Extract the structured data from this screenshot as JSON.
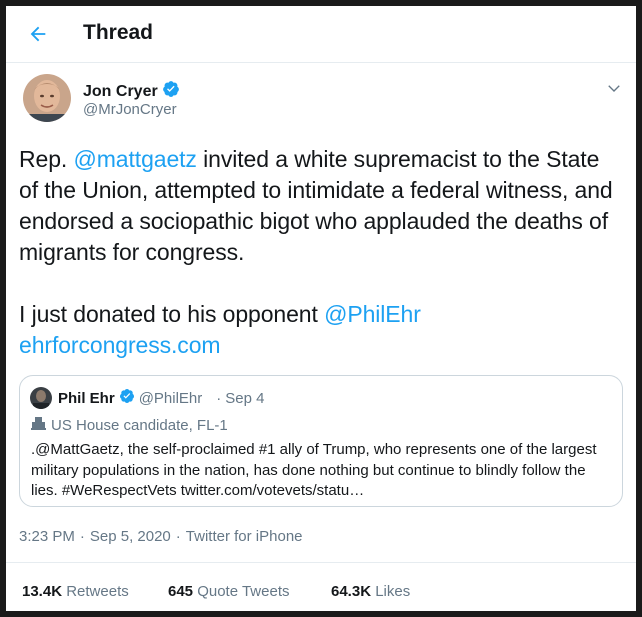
{
  "header": {
    "title": "Thread"
  },
  "tweet": {
    "author_name": "Jon Cryer",
    "author_handle": "@MrJonCryer",
    "line1_pre": "Rep. ",
    "line1_mention": "@mattgaetz",
    "line1_post": " invited a white supremacist to the State of the Union, attempted to intimidate a federal witness, and endorsed a sociopathic bigot who applauded the deaths of migrants for congress.",
    "line2_pre": "I just donated to his opponent ",
    "line2_mention": "@PhilEhr",
    "line3_link": "ehrforcongress.com"
  },
  "quote": {
    "name": "Phil Ehr",
    "handle": "@PhilEhr",
    "sep": "·",
    "date": "Sep 4",
    "label": "US House candidate, FL-1",
    "body": ".@MattGaetz, the self-proclaimed #1 ally of Trump, who represents one of the largest military populations in the nation, has done nothing but continue to blindly follow the lies. #WeRespectVets twitter.com/votevets/statu…"
  },
  "meta": {
    "time": "3:23 PM",
    "sep": "·",
    "date": "Sep 5, 2020",
    "source": "Twitter for iPhone"
  },
  "stats": {
    "retweets_count": "13.4K",
    "retweets_label": "Retweets",
    "quotes_count": "645",
    "quotes_label": "Quote Tweets",
    "likes_count": "64.3K",
    "likes_label": "Likes"
  },
  "colors": {
    "accent": "#1da1f2",
    "text": "#14171a",
    "muted": "#657786",
    "border": "#ccd6dd"
  },
  "icons": {
    "back": "back-arrow-icon",
    "verified": "verified-badge-icon",
    "chevron": "chevron-down-icon",
    "label": "government-building-icon"
  }
}
